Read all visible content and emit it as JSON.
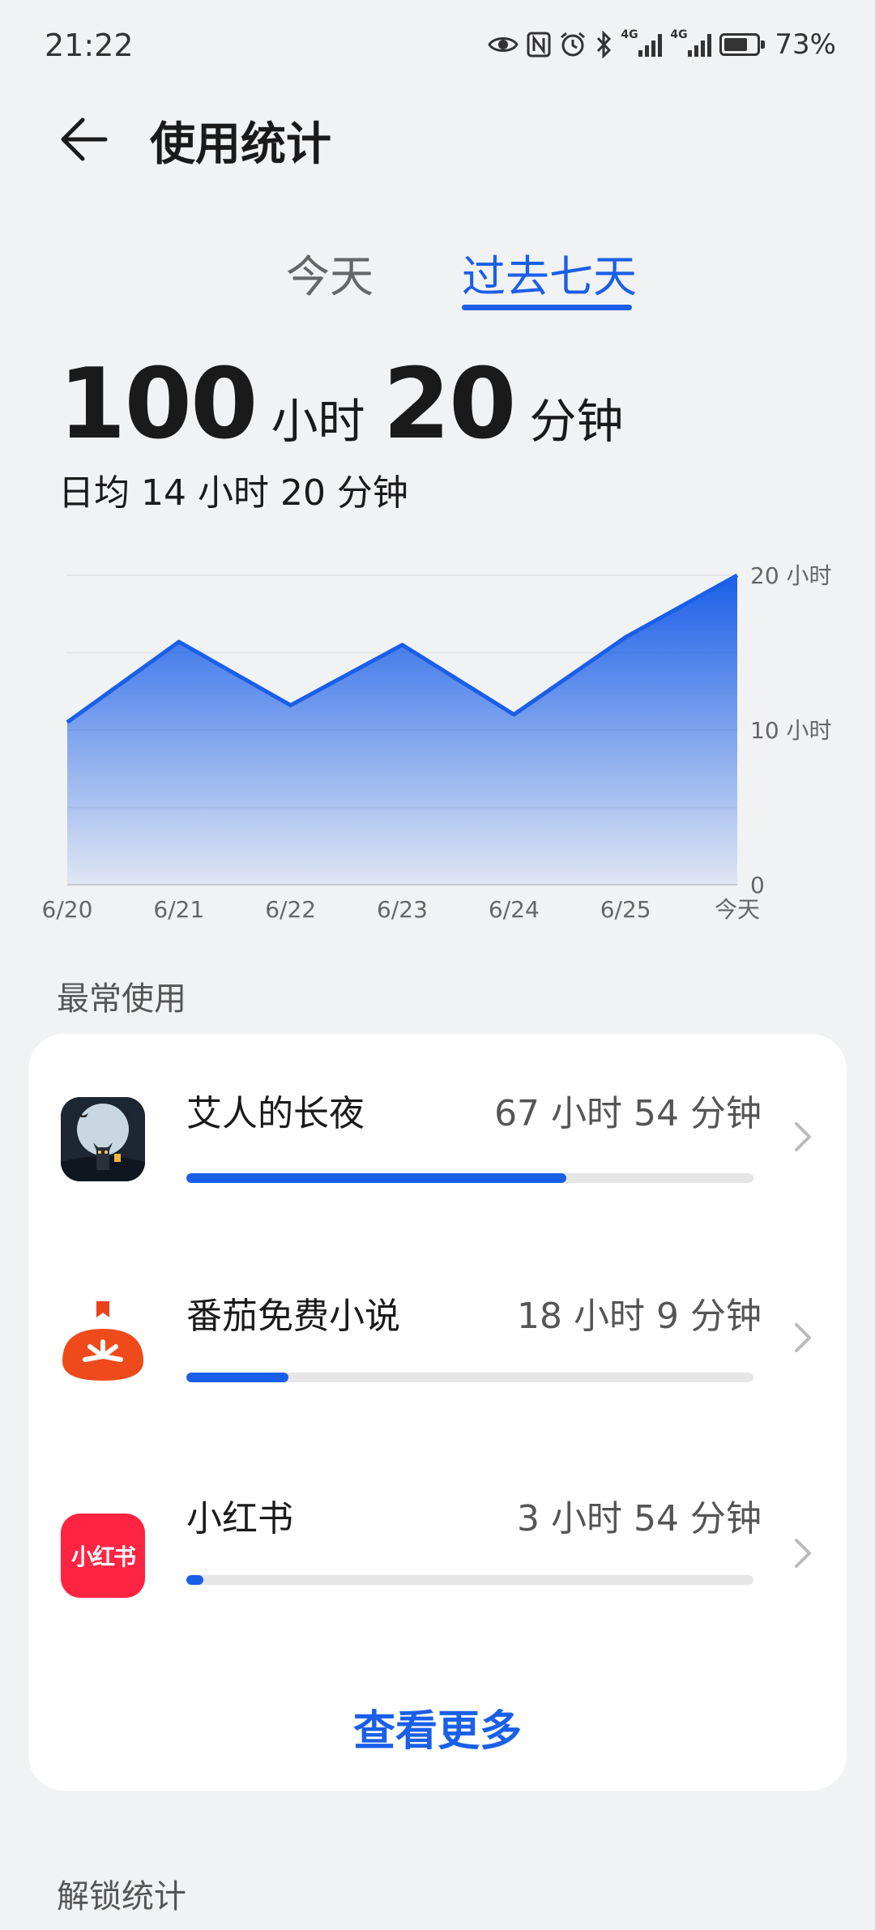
{
  "status_bar": {
    "time": "21:22",
    "net1": "4G",
    "net2": "4G",
    "battery_percent": "73%",
    "battery_level": 0.73,
    "icons": [
      "eye-icon",
      "nfc-icon",
      "alarm-icon",
      "bluetooth-icon",
      "signal-icon",
      "signal-icon",
      "battery-icon"
    ]
  },
  "header": {
    "title": "使用统计",
    "back_icon": "arrow-left-icon"
  },
  "tabs": [
    {
      "label": "今天",
      "selected": false
    },
    {
      "label": "过去七天",
      "selected": true
    }
  ],
  "summary": {
    "hours_value": "100",
    "hours_unit": "小时",
    "minutes_value": "20",
    "minutes_unit": "分钟",
    "average": "日均 14 小时 20 分钟"
  },
  "chart_data": {
    "type": "area",
    "categories": [
      "6/20",
      "6/21",
      "6/22",
      "6/23",
      "6/24",
      "6/25",
      "今天"
    ],
    "series": [
      {
        "values": [
          10.5,
          15.7,
          11.6,
          15.5,
          11.0,
          16.0,
          20.0
        ]
      }
    ],
    "y_ticks": [
      {
        "value": 20,
        "label": "20 小时"
      },
      {
        "value": 10,
        "label": "10 小时"
      },
      {
        "value": 0,
        "label": "0"
      }
    ],
    "ylim": [
      0,
      20
    ],
    "grid": true,
    "y_axis_position": "right",
    "color": "#1a5fe8"
  },
  "frequent": {
    "label": "最常使用",
    "apps": [
      {
        "name": "艾人的长夜",
        "time": "67 小时 54 分钟",
        "fraction": 0.67,
        "icon": "night-cat-game-icon"
      },
      {
        "name": "番茄免费小说",
        "time": "18 小时 9 分钟",
        "fraction": 0.18,
        "icon": "tomato-novel-icon"
      },
      {
        "name": "小红书",
        "time": "3 小时 54 分钟",
        "fraction": 0.03,
        "icon_text": "小红书",
        "icon": "xiaohongshu-icon"
      }
    ],
    "more_label": "查看更多"
  },
  "unlock": {
    "label": "解锁统计"
  },
  "colors": {
    "accent": "#1a5fe8",
    "background": "#f1f2f4",
    "card": "#ffffff",
    "xhs_red": "#ff2442",
    "tomato": "#ee4a1c"
  }
}
